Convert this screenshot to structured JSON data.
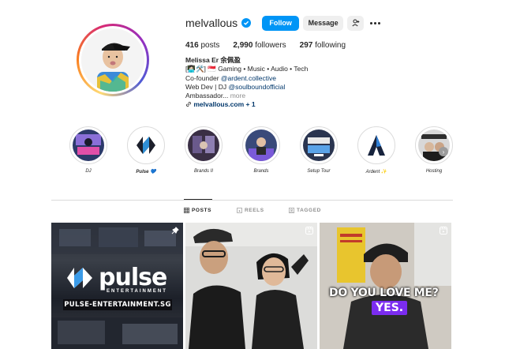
{
  "profile": {
    "username": "melvallous",
    "follow_label": "Follow",
    "message_label": "Message",
    "stats": {
      "posts_count": "416",
      "posts_label": "posts",
      "followers_count": "2,990",
      "followers_label": "followers",
      "following_count": "297",
      "following_label": "following"
    },
    "bio": {
      "name": "Melissa Er 余佩盈",
      "line1": "[👩🏻‍💻🛠️] 🇸🇬 Gaming • Music • Audio • Tech",
      "line2_prefix": "Co-founder ",
      "line2_link": "@ardent.collective",
      "line3_prefix": "Web Dev | DJ ",
      "line3_link": "@soulboundofficial",
      "line4": "Ambassador...",
      "line4_more": " more",
      "url": "melvallous.com + 1"
    }
  },
  "highlights": [
    {
      "label": "DJ"
    },
    {
      "label": "Pulse 💙"
    },
    {
      "label": "Brands II"
    },
    {
      "label": "Brands"
    },
    {
      "label": "Setup Tour"
    },
    {
      "label": "Ardent ✨"
    },
    {
      "label": "Hosting"
    }
  ],
  "tabs": {
    "posts": "POSTS",
    "reels": "REELS",
    "tagged": "TAGGED"
  },
  "posts": {
    "p1_brand": "pulse",
    "p1_sub": "ENTERTAINMENT",
    "p1_site": "PULSE-ENTERTAINMENT.SG",
    "p3_text": "DO YOU LOVE ME?",
    "p3_yes": "YES."
  },
  "colors": {
    "accent": "#0095f6",
    "verified": "#0095f6",
    "link": "#00376b"
  }
}
